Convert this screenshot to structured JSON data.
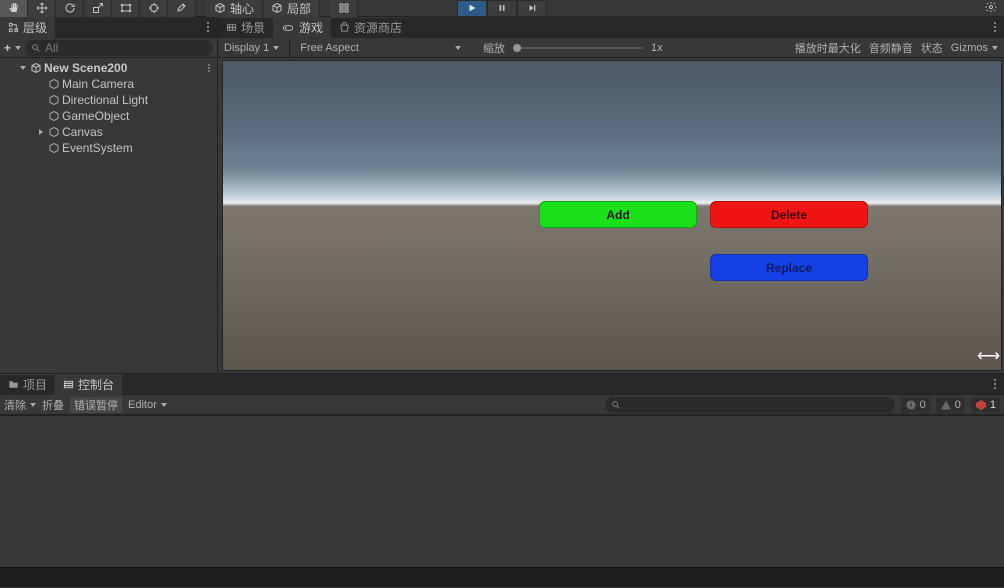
{
  "toolbar": {
    "pivot_label": "轴心",
    "local_label": "局部"
  },
  "hierarchy": {
    "title": "层级",
    "search_placeholder": "All",
    "scene_name": "New Scene200",
    "items": [
      {
        "label": "Main Camera"
      },
      {
        "label": "Directional Light"
      },
      {
        "label": "GameObject"
      },
      {
        "label": "Canvas",
        "expandable": true
      },
      {
        "label": "EventSystem"
      }
    ]
  },
  "game_tabs": {
    "scene": "场景",
    "game": "游戏",
    "asset_store": "资源商店"
  },
  "game_toolbar": {
    "display": "Display 1",
    "aspect": "Free Aspect",
    "scale_label": "缩放",
    "scale_value": "1x",
    "max_on_play": "播放时最大化",
    "mute": "音频静音",
    "state": "状态",
    "gizmos": "Gizmos"
  },
  "game_buttons": {
    "add": "Add",
    "delete": "Delete",
    "replace": "Replace"
  },
  "bottom_tabs": {
    "project": "项目",
    "console": "控制台"
  },
  "console_toolbar": {
    "clear": "清除",
    "collapse": "折叠",
    "error_pause": "错误暂停",
    "editor": "Editor"
  },
  "console_counts": {
    "info": "0",
    "warn": "0",
    "error": "1"
  }
}
